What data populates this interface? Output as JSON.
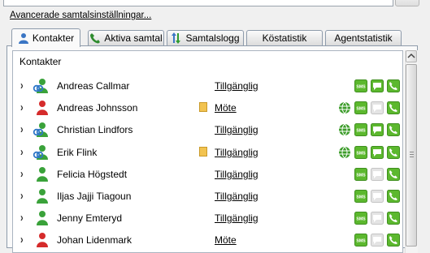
{
  "advanced_link": "Avancerade samtalsinställningar...",
  "tabs": [
    {
      "label": "Kontakter",
      "icon": "person-icon",
      "active": true
    },
    {
      "label": "Aktiva samtal",
      "icon": "phone-icon",
      "active": false
    },
    {
      "label": "Samtalslogg",
      "icon": "call-log-icon",
      "active": false
    },
    {
      "label": "Köstatistik",
      "active": false
    },
    {
      "label": "Agentstatistik",
      "active": false
    }
  ],
  "contacts_title": "Kontakter",
  "contacts": [
    {
      "name": "Andreas Callmar",
      "status": "Tillgänglig",
      "presence": "available",
      "linked": true,
      "note": false,
      "actions": [
        "sms",
        "chat",
        "call"
      ]
    },
    {
      "name": "Andreas Johnsson",
      "status": "Möte",
      "presence": "busy",
      "linked": false,
      "note": true,
      "actions": [
        "web",
        "sms",
        "chat-disabled",
        "call"
      ]
    },
    {
      "name": "Christian Lindfors",
      "status": "Tillgänglig",
      "presence": "available",
      "linked": true,
      "note": false,
      "actions": [
        "web",
        "sms",
        "chat",
        "call"
      ]
    },
    {
      "name": "Erik Flink",
      "status": "Tillgänglig",
      "presence": "available",
      "linked": true,
      "note": true,
      "actions": [
        "web",
        "sms",
        "chat",
        "call"
      ]
    },
    {
      "name": "Felicia Högstedt",
      "status": "Tillgänglig",
      "presence": "available",
      "linked": false,
      "note": false,
      "actions": [
        "sms",
        "chat-disabled",
        "call"
      ]
    },
    {
      "name": "Iljas Jajji Tiagoun",
      "status": "Tillgänglig",
      "presence": "available",
      "linked": false,
      "note": false,
      "actions": [
        "sms",
        "chat-disabled",
        "call"
      ]
    },
    {
      "name": "Jenny Emteryd",
      "status": "Tillgänglig",
      "presence": "available",
      "linked": false,
      "note": false,
      "actions": [
        "sms",
        "chat-disabled",
        "call"
      ]
    },
    {
      "name": "Johan Lidenmark",
      "status": "Möte",
      "presence": "busy",
      "linked": false,
      "note": false,
      "actions": [
        "sms",
        "chat-disabled",
        "call"
      ]
    }
  ],
  "action_text": {
    "sms": "SMS"
  },
  "colors": {
    "available": "#3aa23a",
    "busy": "#d52b2b",
    "linked": "#2f78c8",
    "action_green": "#5cb82e",
    "action_disabled": "#c8c8c8",
    "web_green": "#3c9c2a",
    "note_yellow": "#f2c350"
  }
}
